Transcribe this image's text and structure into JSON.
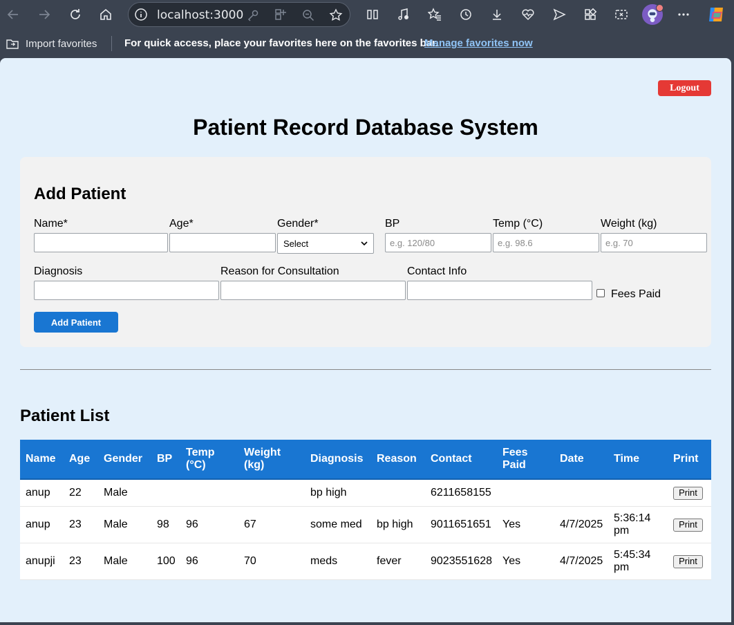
{
  "browser": {
    "url": "localhost:3000",
    "favorites_bar": {
      "import_label": "Import favorites",
      "hint": "For quick access, place your favorites here on the favorites bar.",
      "manage_link": "Manage favorites now"
    }
  },
  "page": {
    "logout_label": "Logout",
    "title": "Patient Record Database System"
  },
  "add_form": {
    "heading": "Add Patient",
    "labels": {
      "name": "Name*",
      "age": "Age*",
      "gender": "Gender*",
      "bp": "BP",
      "temp": "Temp (°C)",
      "weight": "Weight (kg)",
      "diagnosis": "Diagnosis",
      "reason": "Reason for Consultation",
      "contact": "Contact Info",
      "fees_paid": "Fees Paid"
    },
    "placeholders": {
      "bp": "e.g. 120/80",
      "temp": "e.g. 98.6",
      "weight": "e.g. 70"
    },
    "gender_selected": "Select",
    "submit_label": "Add Patient"
  },
  "patient_list": {
    "heading": "Patient List",
    "headers": {
      "name": "Name",
      "age": "Age",
      "gender": "Gender",
      "bp": "BP",
      "temp_l1": "Temp",
      "temp_l2": "(°C)",
      "weight_l1": "Weight",
      "weight_l2": "(kg)",
      "diagnosis": "Diagnosis",
      "reason": "Reason",
      "contact": "Contact",
      "fees_l1": "Fees",
      "fees_l2": "Paid",
      "date": "Date",
      "time": "Time",
      "print": "Print"
    },
    "rows": [
      {
        "name": "anup",
        "age": "22",
        "gender": "Male",
        "bp": "",
        "temp": "",
        "weight": "",
        "diagnosis": "bp high",
        "reason": "",
        "contact": "6211658155",
        "fees_paid": "",
        "date": "",
        "time": "",
        "print_label": "Print"
      },
      {
        "name": "anup",
        "age": "23",
        "gender": "Male",
        "bp": "98",
        "temp": "96",
        "weight": "67",
        "diagnosis": "some med",
        "reason": "bp high",
        "contact": "9011651651",
        "fees_paid": "Yes",
        "date": "4/7/2025",
        "time": "5:36:14 pm",
        "print_label": "Print"
      },
      {
        "name": "anupji",
        "age": "23",
        "gender": "Male",
        "bp": "100",
        "temp": "96",
        "weight": "70",
        "diagnosis": "meds",
        "reason": "fever",
        "contact": "9023551628",
        "fees_paid": "Yes",
        "date": "4/7/2025",
        "time": "5:45:34 pm",
        "print_label": "Print"
      }
    ]
  },
  "colors": {
    "page_bg": "#e3f0fb",
    "accent": "#1976d2",
    "logout": "#e53935",
    "chrome_bg": "#3b4350"
  }
}
